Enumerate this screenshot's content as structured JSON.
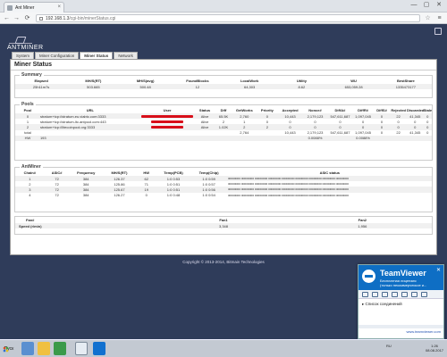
{
  "browser": {
    "tab_title": "Ant Miner",
    "url_host": "192.168.1.3",
    "url_path": "/cgi-bin/minerStatus.cgi",
    "tab_close": "×",
    "min": "—",
    "max": "▢",
    "close": "✕",
    "back": "←",
    "forward": "→",
    "reload": "⟳",
    "star": "☆",
    "menu": "≡"
  },
  "logo": "ANTMINER",
  "nav_tabs": [
    "System",
    "Miner Configuration",
    "Miner Status",
    "Network"
  ],
  "active_tab_index": 2,
  "panel_title": "Miner Status",
  "summary": {
    "legend": "Summary",
    "headers": [
      "Elapsed",
      "MH/S(RT)",
      "MH/S(avg)",
      "FoundBlocks",
      "LocalWork",
      "Utility",
      "WU",
      "BestShare"
    ],
    "values": [
      "25h11m7s",
      "503.665",
      "500.48",
      "12",
      "64,303",
      "8.62",
      "653,059.28",
      "1335473177"
    ]
  },
  "pools": {
    "legend": "Pools",
    "headers": [
      "Pool",
      "URL",
      "User",
      "Status",
      "Diff",
      "GetWorks",
      "Priority",
      "Accepted",
      "Nonce#",
      "DiffA#",
      "DiffR#",
      "DiffS#",
      "Rejected",
      "Discarded",
      "Stale"
    ],
    "rows": [
      [
        "0",
        "stratum+tcp://stratum.eu.viabtc.com:3333",
        "",
        "Alive",
        "65.5K",
        "2,760",
        "0",
        "10,443",
        "2,179,123",
        "547,611,687",
        "1,097,045",
        "0",
        "22",
        "41,345",
        "0"
      ],
      [
        "1",
        "stratum+tcp://stratum-ltc.antpool.com:443",
        "",
        "Alive",
        "2",
        "1",
        "0",
        "0",
        "0",
        "0",
        "0",
        "0",
        "0",
        "0",
        "0"
      ],
      [
        "2",
        "stratum+tcp://litecoinpool.org:3333",
        "",
        "Alive",
        "1.02K",
        "2",
        "2",
        "0",
        "0",
        "0",
        "0",
        "0",
        "0",
        "0",
        "0"
      ],
      [
        "total",
        "",
        "",
        "",
        "",
        "2,764",
        "",
        "10,443",
        "2,179,123",
        "547,611,687",
        "1,097,045",
        "0",
        "22",
        "41,345",
        "0"
      ],
      [
        "HW",
        "193",
        "",
        "",
        "",
        "",
        "",
        "",
        "0.0088%",
        "",
        "0.0088%",
        "",
        "",
        "",
        ""
      ]
    ]
  },
  "antminer": {
    "legend": "AntMiner",
    "headers": [
      "Chain#",
      "ASIC#",
      "Frequency",
      "MH/S(RT)",
      "HW",
      "Temp(PCB)",
      "Temp(Chip)",
      "ASIC status"
    ],
    "rows": [
      [
        "1",
        "72",
        "384",
        "126.37",
        "62",
        "1:0 0:53",
        "1:0 0:59",
        "oooooooo oooooooo oooooooo oooooooo oooooooo oooooooo oooooooo oooooooo oooooooo"
      ],
      [
        "2",
        "72",
        "384",
        "125.86",
        "71",
        "1:0 0:51",
        "1:0 0:57",
        "oooooooo oooooooo oooooooo oooooooo oooooooo oooooooo oooooooo oooooooo oooooooo"
      ],
      [
        "3",
        "72",
        "384",
        "125.67",
        "19",
        "1:0 0:51",
        "1:0 0:56",
        "oooooooo oooooooo oooooooo oooooooo oooooooo oooooooo oooooooo oooooooo oooooooo"
      ],
      [
        "4",
        "72",
        "384",
        "126.27",
        "0",
        "1:0 0:48",
        "1:0 0:54",
        "oooooooo oooooooo oooooooo oooooooo oooooooo oooooooo oooooooo oooooooo oooooooo"
      ]
    ]
  },
  "fans": {
    "headers": [
      "Fan#",
      "Fan1",
      "Fan2"
    ],
    "label": "Speed (r/min)",
    "values": [
      "3,348",
      "1,956"
    ]
  },
  "footer": "Copyright © 2013-2014, Bitmain Technologies",
  "teamviewer": {
    "title": "TeamViewer",
    "license_line1": "Бесплатная лицензия",
    "license_line2": "(только некоммерческое и...",
    "close": "✕",
    "contacts": "Список соединений",
    "link": "www.teamviewer.com"
  },
  "taskbar": {
    "start": "Пуск",
    "lang": "RU",
    "time": "1:26",
    "date": "08.08.2017"
  }
}
